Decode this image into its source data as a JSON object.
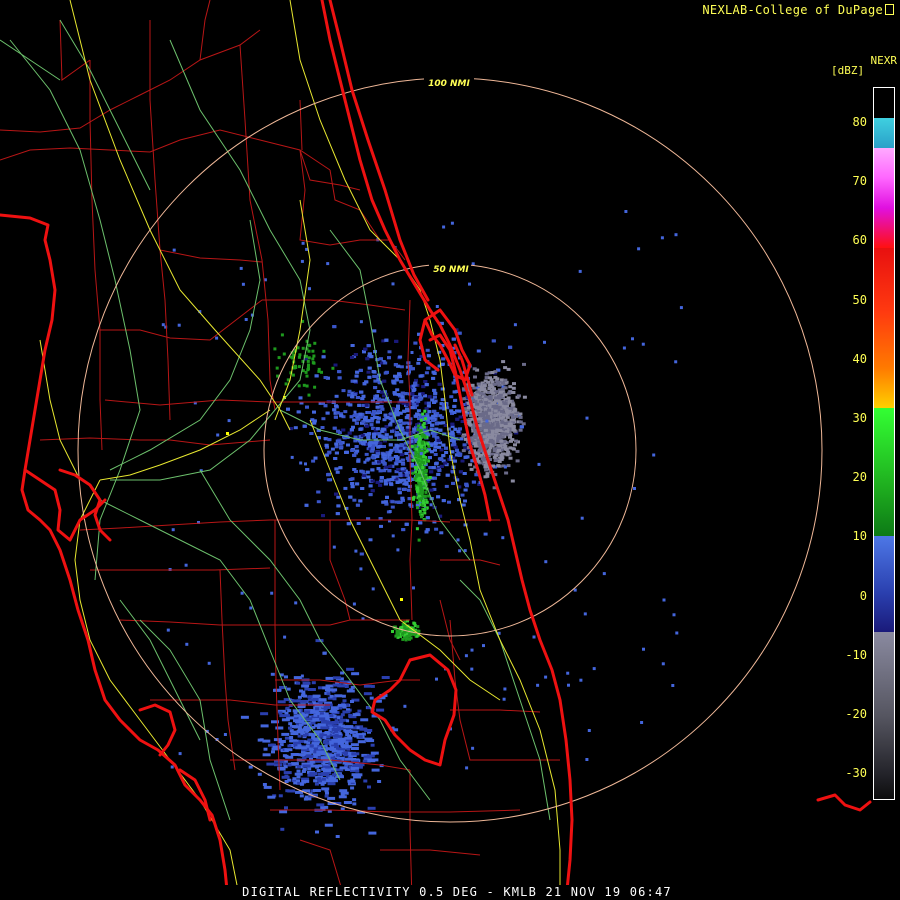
{
  "header": {
    "credit": "NEXLAB-College of DuPage",
    "credit_icon": "external-link-icon"
  },
  "legend": {
    "product": "NEXR",
    "unit": "[dBZ]",
    "ticks": [
      "80",
      "70",
      "60",
      "50",
      "40",
      "30",
      "20",
      "10",
      "0",
      "-10",
      "-20",
      "-30"
    ],
    "colors": {
      "cyan": "#3fd0e0",
      "pink": "#ff66ff",
      "magenta": "#e010e0",
      "red": "#e81010",
      "orange": "#ff7a00",
      "yellow": "#ffff00",
      "green": "#33cc33",
      "dark_green": "#0d7a16",
      "blue": "#4466dd",
      "navy": "#1a1a7a",
      "gray": "#8a8aa0",
      "dark_gray": "#222228"
    }
  },
  "map": {
    "range_rings": [
      "100 NMI",
      "50 NMI"
    ],
    "colors": {
      "coastline": "#ee1111",
      "county_lines": "#c01818",
      "roads": "#e8e830",
      "highways": "#70c070",
      "rings": "#f0c0a0"
    }
  },
  "footer": {
    "caption": "DIGITAL REFLECTIVITY 0.5 DEG - KMLB 21 NOV 19 06:47"
  }
}
